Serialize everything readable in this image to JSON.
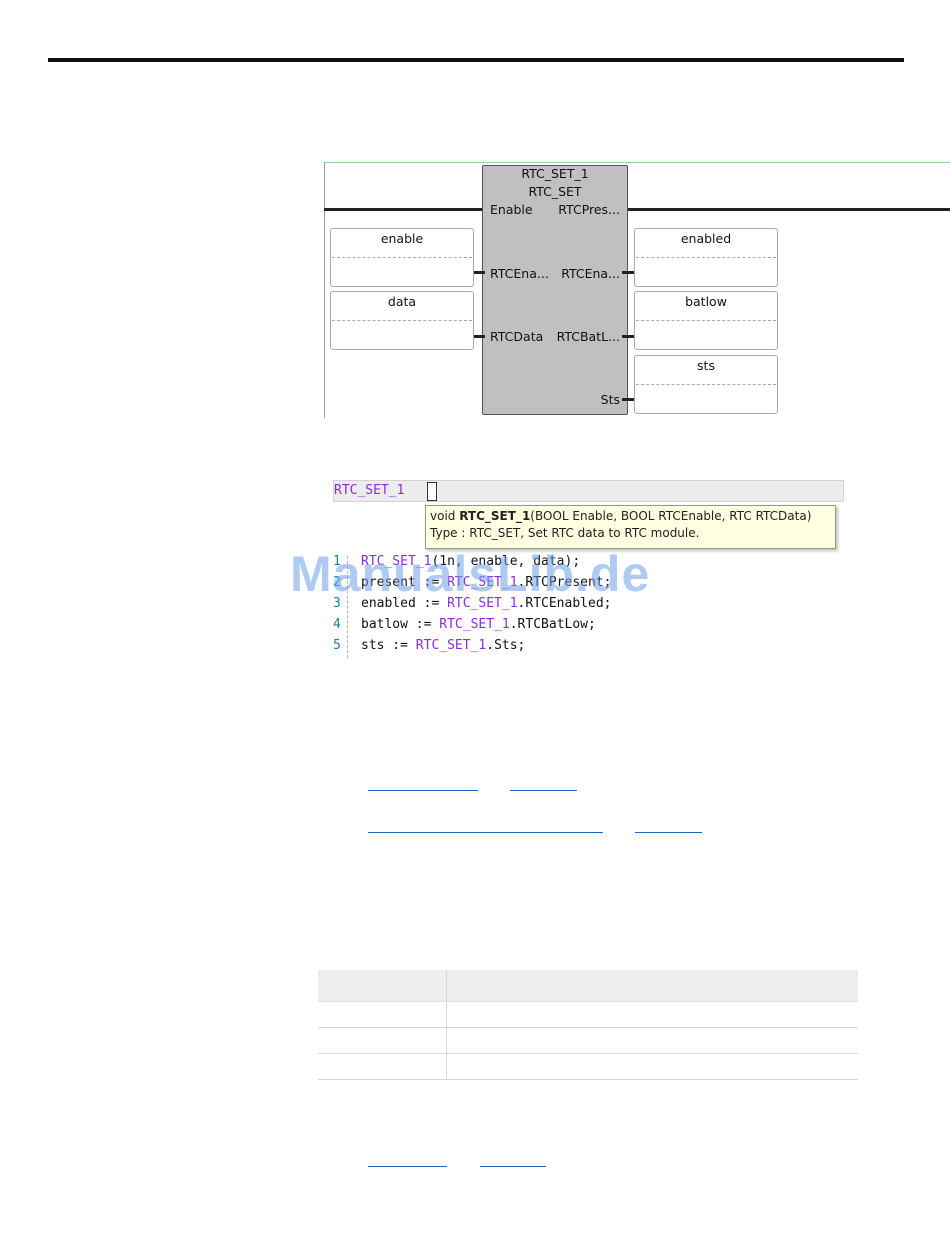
{
  "fbd": {
    "instance_name": "RTC_SET_1",
    "block_type": "RTC_SET",
    "inputs": [
      {
        "label": "Enable"
      },
      {
        "label": "RTCEna..."
      },
      {
        "label": "RTCData"
      }
    ],
    "outputs": [
      {
        "label": "RTCPres..."
      },
      {
        "label": "RTCEna..."
      },
      {
        "label": "RTCBatL..."
      },
      {
        "label": "Sts"
      }
    ],
    "input_vars": [
      "enable",
      "data"
    ],
    "output_vars": [
      "enabled",
      "batlow",
      "sts"
    ]
  },
  "st": {
    "input_text": "RTC_SET_1",
    "tooltip": {
      "prefix": "void ",
      "name": "RTC_SET_1",
      "params": "(BOOL Enable, BOOL RTCEnable, RTC RTCData)",
      "type_line": "Type : RTC_SET, Set RTC data to RTC module."
    },
    "lines": [
      {
        "num": "1",
        "pre": "",
        "id": "RTC_SET_1",
        "post": "(1n, enable, data);"
      },
      {
        "num": "2",
        "pre": "present := ",
        "id": "RTC_SET_1",
        "post": ".RTCPresent;"
      },
      {
        "num": "3",
        "pre": "enabled := ",
        "id": "RTC_SET_1",
        "post": ".RTCEnabled;"
      },
      {
        "num": "4",
        "pre": "batlow := ",
        "id": "RTC_SET_1",
        "post": ".RTCBatLow;"
      },
      {
        "num": "5",
        "pre": "sts := ",
        "id": "RTC_SET_1",
        "post": ".Sts;"
      }
    ]
  },
  "watermark": "ManualsLib.de",
  "links": [
    "",
    "",
    "",
    "",
    "",
    ""
  ],
  "table": {
    "headers": [
      "",
      ""
    ],
    "rows": [
      [
        "",
        ""
      ],
      [
        "",
        ""
      ],
      [
        "",
        ""
      ]
    ]
  }
}
